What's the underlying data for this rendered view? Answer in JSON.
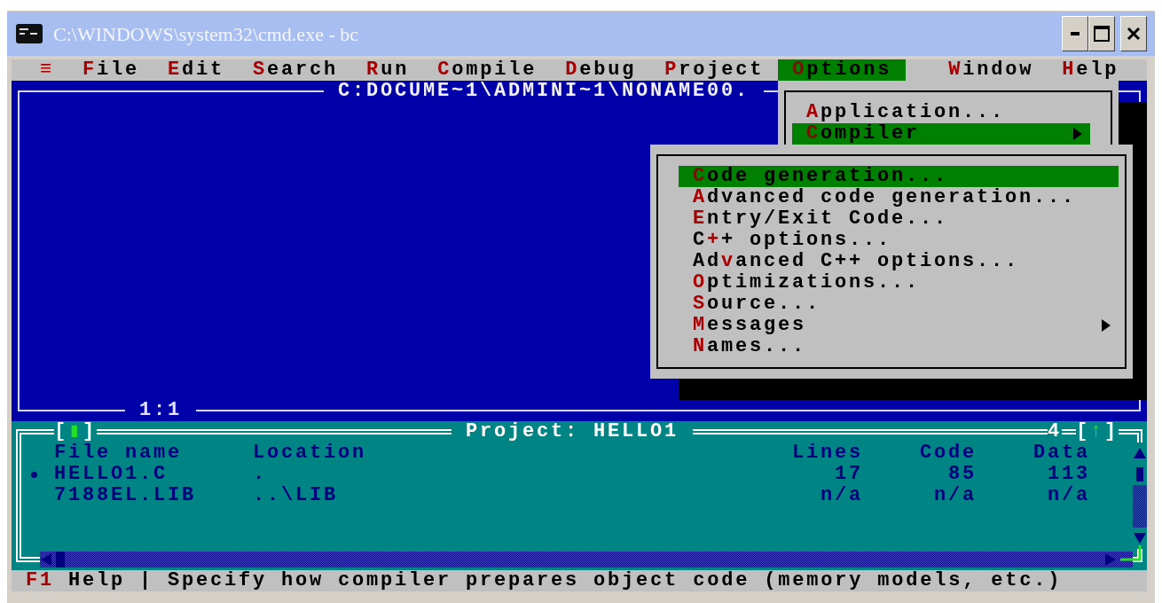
{
  "window": {
    "title": "C:\\WINDOWS\\system32\\cmd.exe - bc"
  },
  "menu_bar": [
    {
      "hotkey": "≡",
      "selected": false
    },
    {
      "hotkey": "F",
      "rest": "ile",
      "selected": false
    },
    {
      "hotkey": "E",
      "rest": "dit",
      "selected": false
    },
    {
      "hotkey": "S",
      "rest": "earch",
      "selected": false
    },
    {
      "hotkey": "R",
      "rest": "un",
      "selected": false
    },
    {
      "hotkey": "C",
      "rest": "ompile",
      "selected": false
    },
    {
      "hotkey": "D",
      "rest": "ebug",
      "selected": false
    },
    {
      "hotkey": "P",
      "rest": "roject",
      "selected": false
    },
    {
      "hotkey": "O",
      "rest": "ptions",
      "selected": true
    },
    {
      "hotkey": "W",
      "rest": "indow",
      "selected": false
    },
    {
      "hotkey": "H",
      "rest": "elp",
      "selected": false
    }
  ],
  "editor": {
    "title": "C:DOCUME~1\\ADMINI~1\\NONAME00.",
    "cursor_position": "1:1"
  },
  "options_menu": {
    "items": [
      {
        "hotkey": "A",
        "rest": "pplication...",
        "selected": false,
        "has_submenu": false
      },
      {
        "hotkey": "C",
        "rest": "ompiler",
        "selected": true,
        "has_submenu": true
      }
    ]
  },
  "compiler_submenu": {
    "items": [
      {
        "hotkey": "C",
        "rest": "ode generation...",
        "selected": true,
        "has_submenu": false
      },
      {
        "hotkey": "A",
        "rest": "dvanced code generation...",
        "selected": false,
        "has_submenu": false
      },
      {
        "hotkey": "E",
        "rest": "ntry/Exit Code...",
        "selected": false,
        "has_submenu": false
      },
      {
        "lead": "C",
        "hotkey": "+",
        "rest": "+ options...",
        "selected": false,
        "has_submenu": false
      },
      {
        "lead": "Ad",
        "hotkey": "v",
        "rest": "anced C++ options...",
        "selected": false,
        "has_submenu": false
      },
      {
        "hotkey": "O",
        "rest": "ptimizations...",
        "selected": false,
        "has_submenu": false
      },
      {
        "hotkey": "S",
        "rest": "ource...",
        "selected": false,
        "has_submenu": false
      },
      {
        "hotkey": "M",
        "rest": "essages",
        "selected": false,
        "has_submenu": true
      },
      {
        "hotkey": "N",
        "rest": "ames...",
        "selected": false,
        "has_submenu": false
      }
    ]
  },
  "project": {
    "close_button": "[▮]",
    "title": "Project: HELLO1",
    "window_number": "4",
    "zoom_button": "[↑]",
    "columns": [
      "File name",
      "Location",
      "Lines",
      "Code",
      "Data"
    ],
    "rows": [
      {
        "current": true,
        "cells": [
          "HELLO1.C",
          ".",
          "17",
          "85",
          "113"
        ]
      },
      {
        "current": false,
        "cells": [
          "7188EL.LIB",
          "..\\LIB",
          "n/a",
          "n/a",
          "n/a"
        ]
      }
    ]
  },
  "status_bar": {
    "key": "F1",
    "key_label": "Help",
    "separator": "|",
    "hint": "Specify how compiler prepares object code (memory models, etc.)"
  }
}
